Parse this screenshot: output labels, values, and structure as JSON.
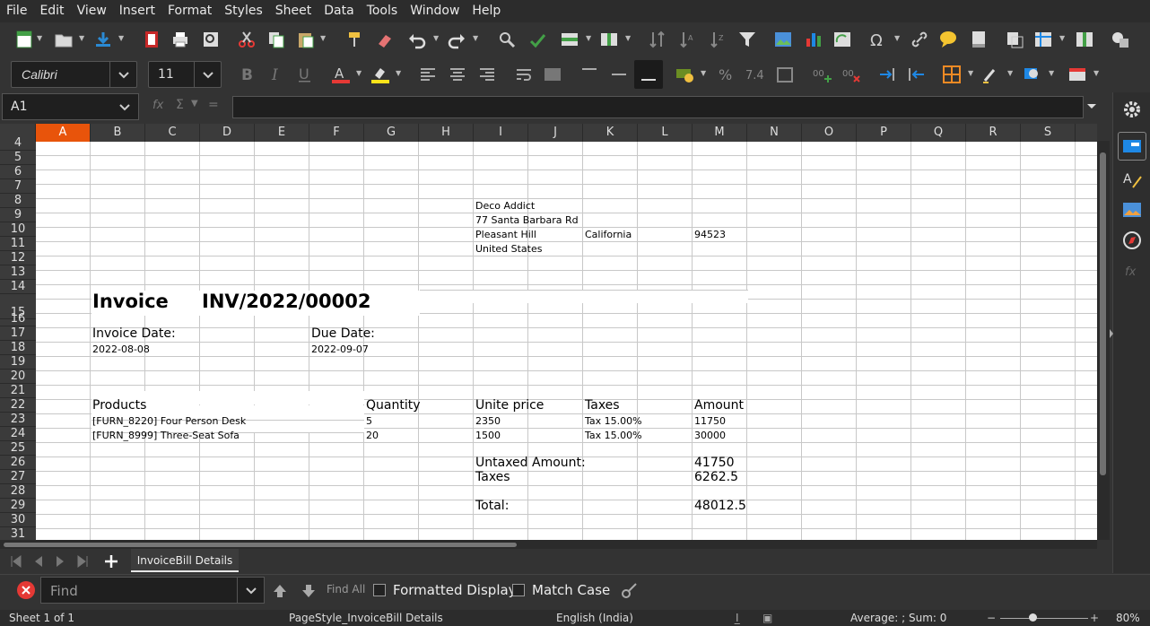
{
  "menu": [
    "File",
    "Edit",
    "View",
    "Insert",
    "Format",
    "Styles",
    "Sheet",
    "Data",
    "Tools",
    "Window",
    "Help"
  ],
  "font_name": "Calibri",
  "font_size": "11",
  "name_box": "A1",
  "formula_symbols": {
    "fx": "fx",
    "sigma": "Σ",
    "eq": "="
  },
  "columns": [
    "A",
    "B",
    "C",
    "D",
    "E",
    "F",
    "G",
    "H",
    "I",
    "J",
    "K",
    "L",
    "M",
    "N",
    "O",
    "P",
    "Q",
    "R",
    "S"
  ],
  "active_column": "A",
  "rows": [
    "4",
    "5",
    "6",
    "7",
    "8",
    "9",
    "10",
    "11",
    "12",
    "13",
    "14",
    "15",
    "16",
    "17",
    "18",
    "19",
    "20",
    "21",
    "22",
    "23",
    "24",
    "25",
    "26",
    "27",
    "28",
    "29",
    "30",
    "31"
  ],
  "cells": {
    "company": "Deco Addict",
    "street": "77 Santa Barbara Rd",
    "city": "Pleasant Hill",
    "state": "California",
    "zip": "94523",
    "country": "United States",
    "invoice_label": "Invoice",
    "invoice_no": "INV/2022/00002",
    "invoice_date_label": "Invoice Date:",
    "invoice_date": "2022-08-08",
    "due_date_label": "Due Date:",
    "due_date": "2022-09-07",
    "h_products": "Products",
    "h_quantity": "Quantity",
    "h_unit_price": "Unite price",
    "h_taxes": "Taxes",
    "h_amount": "Amount",
    "lines": [
      {
        "product": "[FURN_8220] Four Person Desk",
        "qty": "5",
        "price": "2350",
        "tax": "Tax 15.00%",
        "amount": "11750"
      },
      {
        "product": "[FURN_8999] Three-Seat Sofa",
        "qty": "20",
        "price": "1500",
        "tax": "Tax 15.00%",
        "amount": "30000"
      }
    ],
    "untaxed_label": "Untaxed Amount:",
    "untaxed_value": "41750",
    "taxes_label": "Taxes",
    "taxes_value": "6262.5",
    "total_label": "Total:",
    "total_value": "48012.5"
  },
  "sheet_tab": "InvoiceBill Details",
  "find": {
    "placeholder": "Find",
    "find_all": "Find All",
    "formatted_display": "Formatted Display",
    "match_case": "Match Case"
  },
  "status": {
    "sheet": "Sheet 1 of 1",
    "page_style": "PageStyle_InvoiceBill Details",
    "language": "English (India)",
    "summary": "Average: ; Sum: 0",
    "zoom": "80%"
  },
  "accent_color": "#e8540b"
}
